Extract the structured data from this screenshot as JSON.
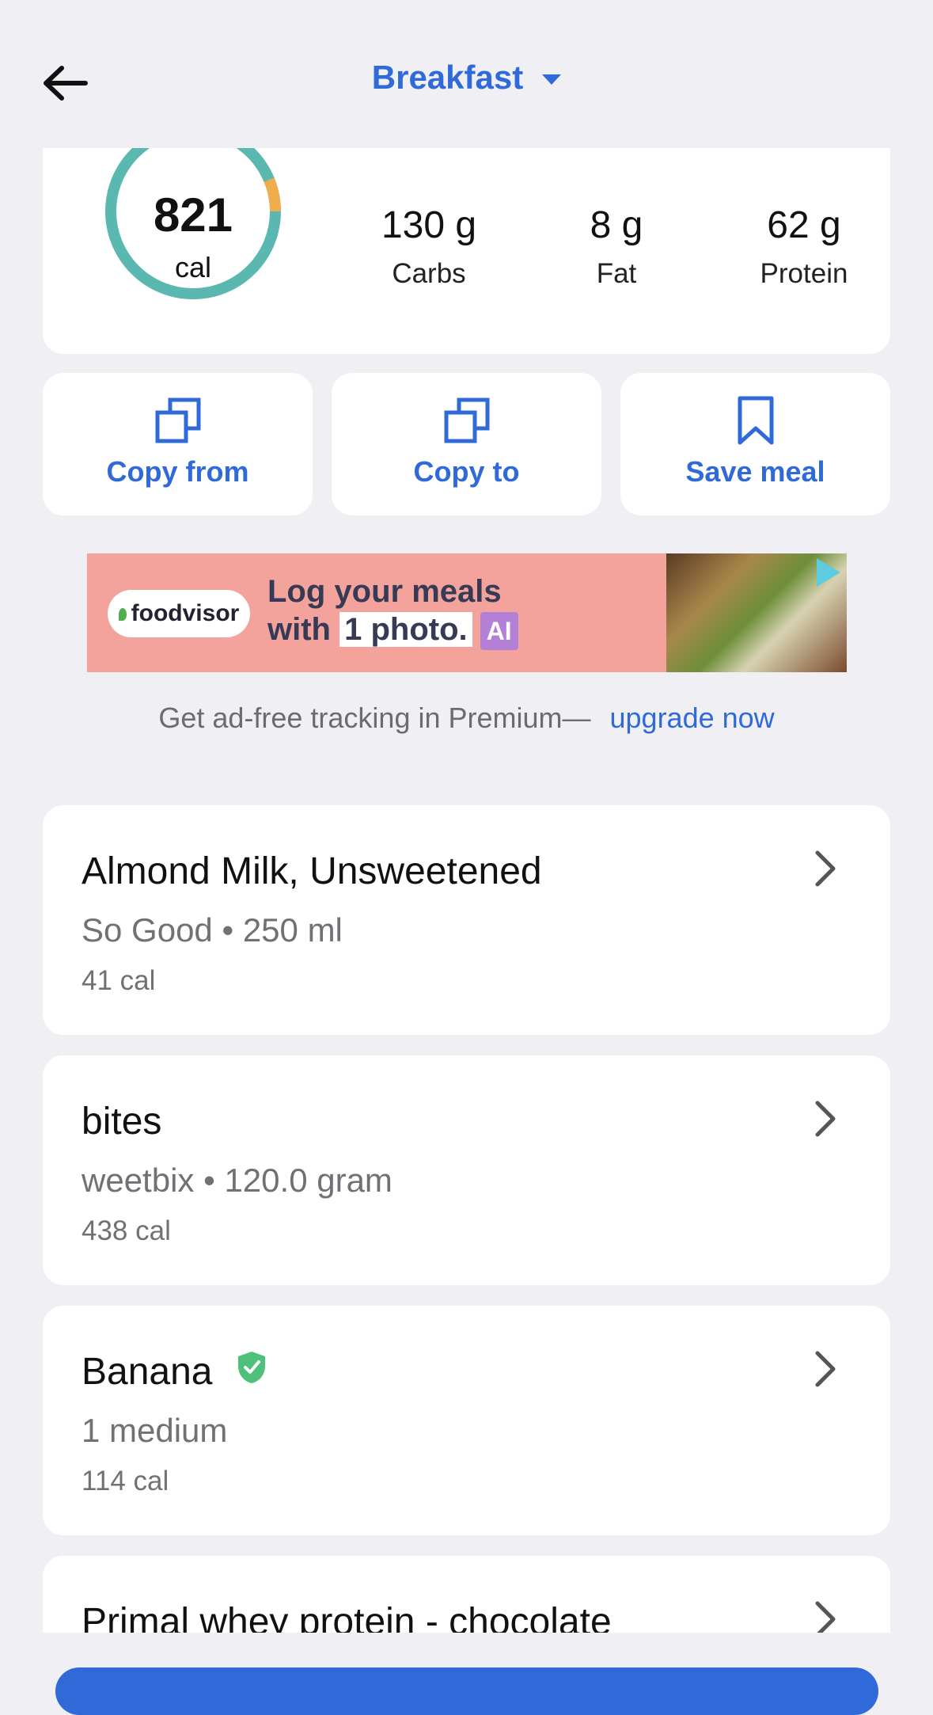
{
  "header": {
    "title": "Breakfast"
  },
  "summary": {
    "calories": "821",
    "calories_unit": "cal",
    "macros": [
      {
        "value": "130 g",
        "label": "Carbs"
      },
      {
        "value": "8 g",
        "label": "Fat"
      },
      {
        "value": "62 g",
        "label": "Protein"
      }
    ]
  },
  "actions": [
    {
      "label": "Copy from",
      "icon": "copy-icon"
    },
    {
      "label": "Copy to",
      "icon": "copy-icon"
    },
    {
      "label": "Save meal",
      "icon": "bookmark-icon"
    }
  ],
  "ad": {
    "brand": "foodvisor",
    "line1": "Log your meals",
    "line2_a": "with",
    "line2_b": "1 photo.",
    "badge": "AI"
  },
  "premium": {
    "text": "Get ad-free tracking in Premium—",
    "link": "upgrade now"
  },
  "foods": [
    {
      "name": "Almond Milk, Unsweetened",
      "sub": "So Good • 250 ml",
      "cal": "41 cal",
      "verified": false
    },
    {
      "name": "bites",
      "sub": "weetbix • 120.0 gram",
      "cal": "438 cal",
      "verified": false
    },
    {
      "name": "Banana",
      "sub": "1 medium",
      "cal": "114 cal",
      "verified": true
    },
    {
      "name": "Primal whey protein - chocolate",
      "sub": "",
      "cal": "",
      "verified": false
    }
  ],
  "colors": {
    "accent": "#2f6ad8",
    "ring_main": "#5bb8b1",
    "ring_secondary": "#f0ad4e",
    "verified": "#4fc07a"
  }
}
